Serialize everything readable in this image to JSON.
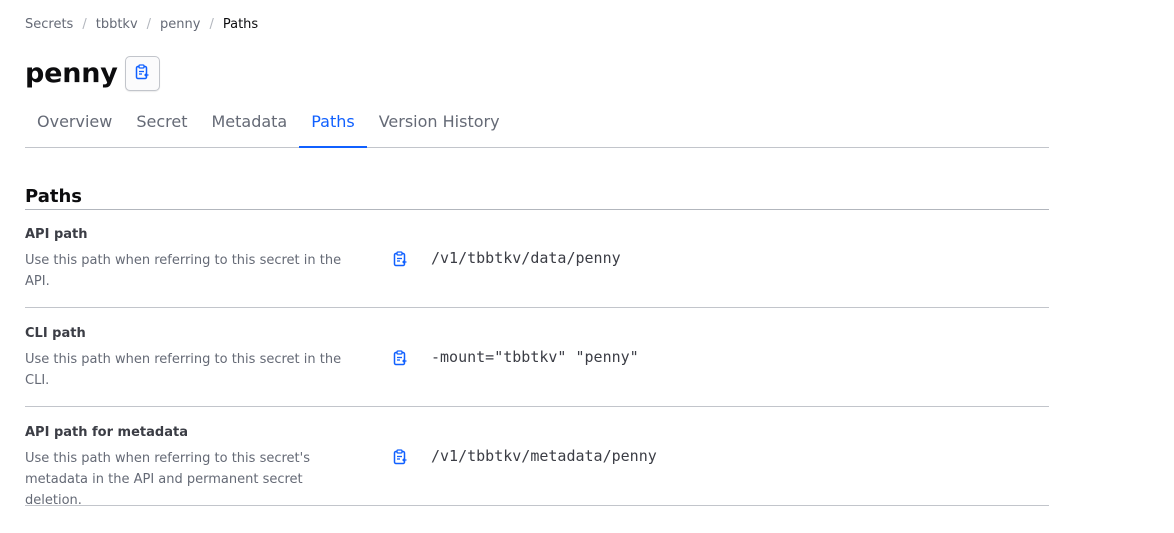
{
  "breadcrumb": [
    {
      "label": "Secrets"
    },
    {
      "label": "tbbtkv"
    },
    {
      "label": "penny"
    },
    {
      "label": "Paths"
    }
  ],
  "breadcrumb_separator": "/",
  "page_title": "penny",
  "tabs": [
    {
      "label": "Overview",
      "active": false
    },
    {
      "label": "Secret",
      "active": false
    },
    {
      "label": "Metadata",
      "active": false
    },
    {
      "label": "Paths",
      "active": true
    },
    {
      "label": "Version History",
      "active": false
    }
  ],
  "section_title": "Paths",
  "paths": [
    {
      "label": "API path",
      "description": "Use this path when referring to this secret in the API.",
      "value": "/v1/tbbtkv/data/penny",
      "copy_icon": "clipboard-icon"
    },
    {
      "label": "CLI path",
      "description": "Use this path when referring to this secret in the CLI.",
      "value": "-mount=\"tbbtkv\" \"penny\"",
      "copy_icon": "clipboard-icon"
    },
    {
      "label": "API path for metadata",
      "description": "Use this path when referring to this secret's metadata in the API and permanent secret deletion.",
      "value": "/v1/tbbtkv/metadata/penny",
      "copy_icon": "clipboard-icon"
    }
  ],
  "colors": {
    "accent": "#1060ff",
    "muted_text": "#656a76",
    "border": "#c2c5cb"
  }
}
